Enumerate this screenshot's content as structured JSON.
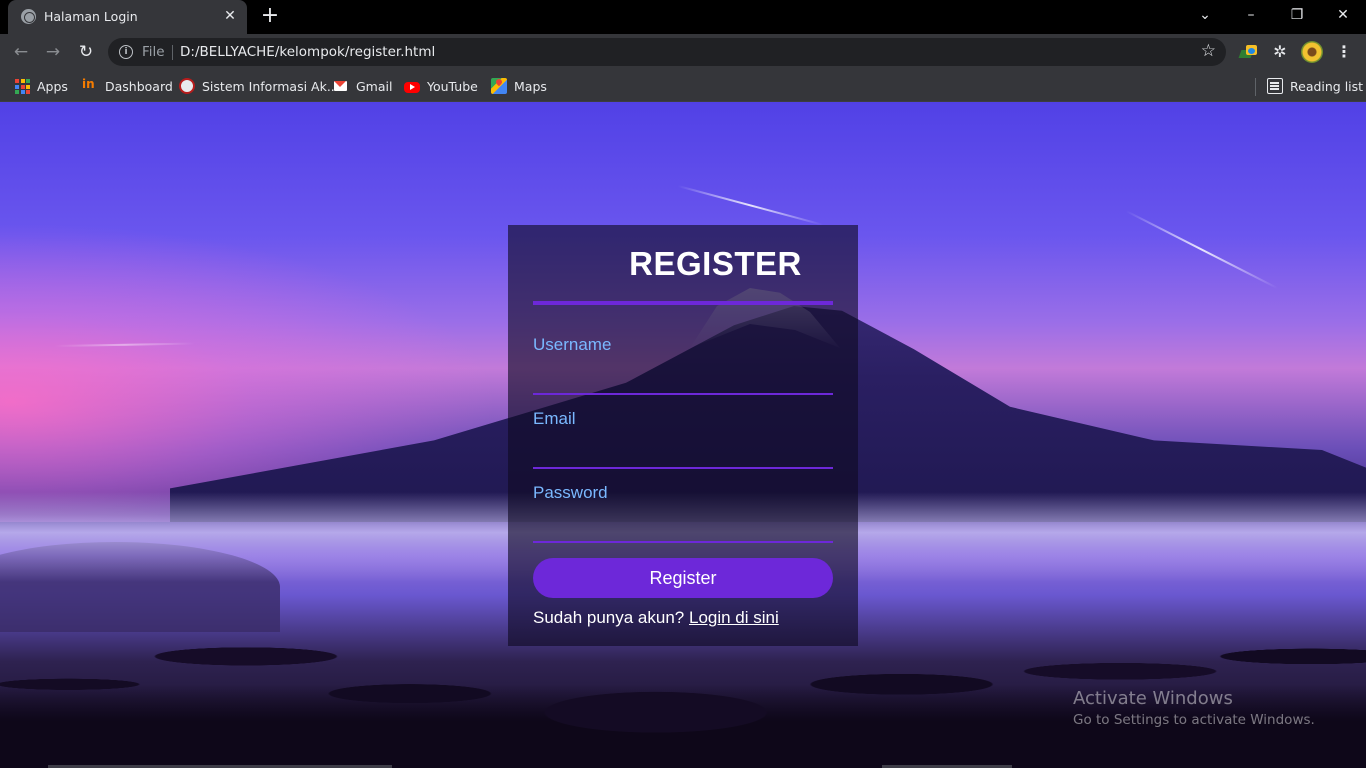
{
  "browser": {
    "tab_title": "Halaman Login",
    "tab_close": "✕",
    "new_tab": "+",
    "window_controls": {
      "tab_search": "⌄",
      "minimize": "–",
      "restore": "❐",
      "close": "✕"
    },
    "nav": {
      "back": "←",
      "forward": "→",
      "reload": "↻"
    },
    "omnibox": {
      "info_icon": "i",
      "scheme_label": "File",
      "url": "D:/BELLYACHE/kelompok/register.html",
      "bookmark_star": "☆"
    },
    "extensions_icon": "✲",
    "menu_icon": "⋮",
    "bookmarks": [
      {
        "label": "Apps",
        "icon": "apps-grid-icon"
      },
      {
        "label": "Dashboard",
        "icon": "dashboard-icon"
      },
      {
        "label": "Sistem Informasi Ak...",
        "icon": "university-icon"
      },
      {
        "label": "Gmail",
        "icon": "gmail-icon"
      },
      {
        "label": "YouTube",
        "icon": "youtube-icon"
      },
      {
        "label": "Maps",
        "icon": "maps-icon"
      }
    ],
    "reading_list": "Reading list"
  },
  "page": {
    "title": "REGISTER",
    "fields": [
      {
        "label": "Username",
        "value": ""
      },
      {
        "label": "Email",
        "value": ""
      },
      {
        "label": "Password",
        "value": ""
      }
    ],
    "submit_label": "Register",
    "footer_prompt": "Sudah punya akun?",
    "footer_link": "Login di sini"
  },
  "watermark": {
    "line1": "Activate Windows",
    "line2": "Go to Settings to activate Windows."
  },
  "colors": {
    "accent": "#6d28d9",
    "label": "#7ab8ff",
    "card_bg": "rgba(14,10,34,0.62)"
  }
}
